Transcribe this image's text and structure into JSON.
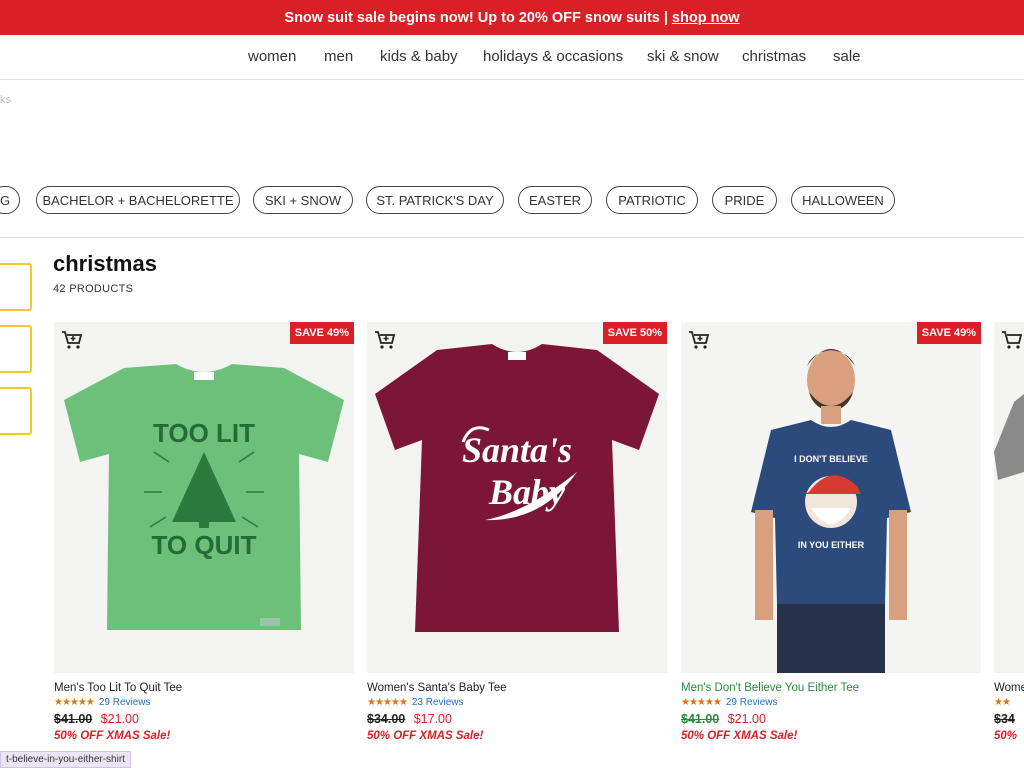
{
  "promo": {
    "text": "Snow suit sale begins now! Up to 20% OFF snow suits |",
    "link": "shop now"
  },
  "nav": [
    "women",
    "men",
    "kids & baby",
    "holidays & occasions",
    "ski & snow",
    "christmas",
    "sale"
  ],
  "breadcrumb": "ks",
  "pills": [
    "G",
    "BACHELOR + BACHELORETTE",
    "SKI + SNOW",
    "ST. PATRICK'S DAY",
    "EASTER",
    "PATRIOTIC",
    "PRIDE",
    "HALLOWEEN"
  ],
  "page": {
    "title": "christmas",
    "count": "42 PRODUCTS"
  },
  "products": [
    {
      "name": "Men's Too Lit To Quit Tee",
      "stars": "★★★★★",
      "reviews": "29 Reviews",
      "old_price": "$41.00",
      "new_price": "$21.00",
      "save": "SAVE 49%",
      "note": "50% OFF XMAS Sale!",
      "shirt_color": "#6cc07a",
      "art_lines": [
        "TOO LIT",
        "TO QUIT"
      ]
    },
    {
      "name": "Women's Santa's Baby Tee",
      "stars": "★★★★★",
      "reviews": "23 Reviews",
      "old_price": "$34.00",
      "new_price": "$17.00",
      "save": "SAVE 50%",
      "note": "50% OFF XMAS Sale!",
      "shirt_color": "#7c1638",
      "art_lines": [
        "Santa's",
        "Baby"
      ]
    },
    {
      "name": "Men's Don't Believe You Either Tee",
      "stars": "★★★★★",
      "reviews": "29 Reviews",
      "old_price": "$41.00",
      "new_price": "$21.00",
      "save": "SAVE 49%",
      "note": "50% OFF XMAS Sale!",
      "shirt_color": "#2c4a7c",
      "art_lines": [
        "I DON'T BELIEVE",
        "IN YOU EITHER"
      ]
    },
    {
      "name": "Wome",
      "stars": "★★",
      "reviews": "",
      "old_price": "$34",
      "new_price": "",
      "save": "",
      "note": "50%",
      "shirt_color": "#8a8a8a",
      "art_lines": []
    }
  ],
  "status_url": "t-believe-in-you-either-shirt"
}
